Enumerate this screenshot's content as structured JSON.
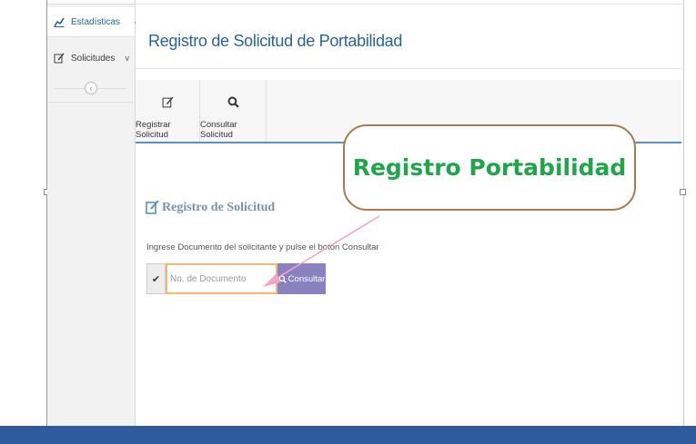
{
  "sidebar": {
    "items": [
      {
        "label": "Estadísticas",
        "icon": "line-chart-icon",
        "active": true
      },
      {
        "label": "Solicitudes",
        "icon": "edit-icon",
        "has_submenu": true
      }
    ],
    "collapse_icon": "chevron-left-icon"
  },
  "header": {
    "title": "Registro de Solicitud de Portabilidad"
  },
  "toolbar": {
    "buttons": [
      {
        "label": "Registrar Solicitud",
        "icon": "edit-icon"
      },
      {
        "label": "Consultar Solicitud",
        "icon": "search-icon"
      }
    ]
  },
  "form": {
    "section_title": "Registro de Solicitud",
    "instruction": "Ingrese Documento del solicitante y pulse el botón Consultar",
    "document_input": {
      "placeholder": "No. de Documento",
      "value": ""
    },
    "consult_button": "Consultar"
  },
  "callout": {
    "text": "Registro Portabilidad",
    "border_color": "#a87a4f",
    "text_color": "#1fa54a"
  },
  "colors": {
    "accent": "#2a6496",
    "button": "#8a82c0",
    "footer": "#2d5b9e",
    "arrow": "#f2a6c4"
  }
}
